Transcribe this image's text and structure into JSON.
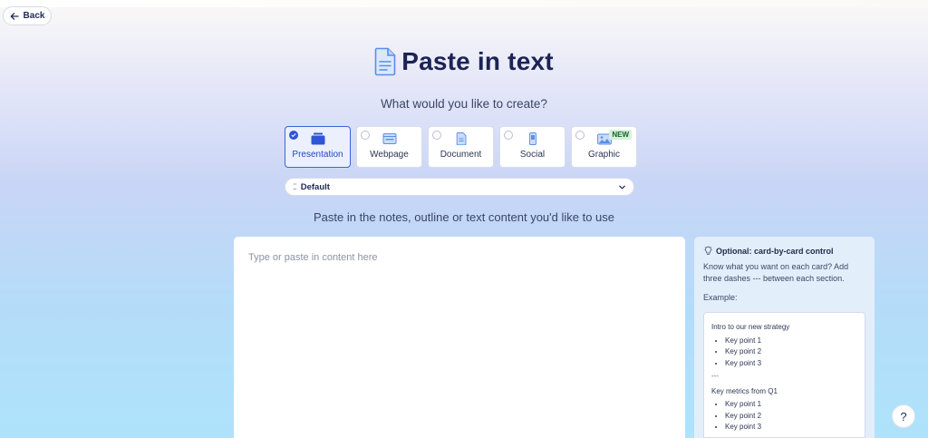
{
  "nav": {
    "back_label": "Back"
  },
  "header": {
    "title": "Paste in text",
    "subtitle": "What would you like to create?"
  },
  "types": [
    {
      "label": "Presentation",
      "selected": true,
      "icon": "presentation-icon"
    },
    {
      "label": "Webpage",
      "selected": false,
      "icon": "webpage-icon"
    },
    {
      "label": "Document",
      "selected": false,
      "icon": "document-icon"
    },
    {
      "label": "Social",
      "selected": false,
      "icon": "social-icon"
    },
    {
      "label": "Graphic",
      "selected": false,
      "icon": "graphic-icon",
      "badge": "NEW"
    }
  ],
  "theme_select": {
    "value": "Default"
  },
  "content": {
    "instructions": "Paste in the notes, outline or text content you'd like to use",
    "placeholder": "Type or paste in content here"
  },
  "tip": {
    "title": "Optional: card-by-card control",
    "body": "Know what you want on each card? Add three dashes --- between each section.",
    "example_label": "Example:",
    "example": {
      "section1_title": "Intro to our new strategy",
      "section1_points": [
        "Key point 1",
        "Key point 2",
        "Key point 3"
      ],
      "separator": "---",
      "section2_title": "Key metrics from Q1",
      "section2_points": [
        "Key point 1",
        "Key point 2",
        "Key point 3"
      ]
    }
  },
  "help": {
    "label": "?"
  },
  "colors": {
    "accent": "#2f55d4",
    "title": "#1b2454",
    "new_badge_bg": "#d4f1d9"
  }
}
